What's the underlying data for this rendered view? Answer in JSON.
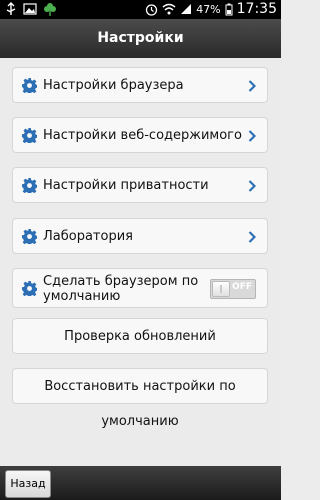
{
  "status_bar": {
    "icons": [
      "usb-icon",
      "image-icon",
      "clover-icon",
      "alarm-icon",
      "wifi-icon",
      "signal-icon",
      "battery-icon"
    ],
    "battery": "47%",
    "time": "17:35"
  },
  "header": {
    "title": "Настройки"
  },
  "menu": {
    "browser_settings": "Настройки браузера",
    "web_content_settings": "Настройки веб-содержимого",
    "privacy_settings": "Настройки приватности",
    "laboratory": "Лаборатория",
    "default_browser": "Сделать браузером по умолчанию",
    "default_toggle_state": "OFF",
    "check_updates": "Проверка обновлений",
    "restore_defaults": "Восстановить настройки по умолчанию"
  },
  "footer": {
    "back_label": "Назад"
  },
  "colors": {
    "accent_blue": "#2d6fb4",
    "title_bar": "#333333"
  }
}
